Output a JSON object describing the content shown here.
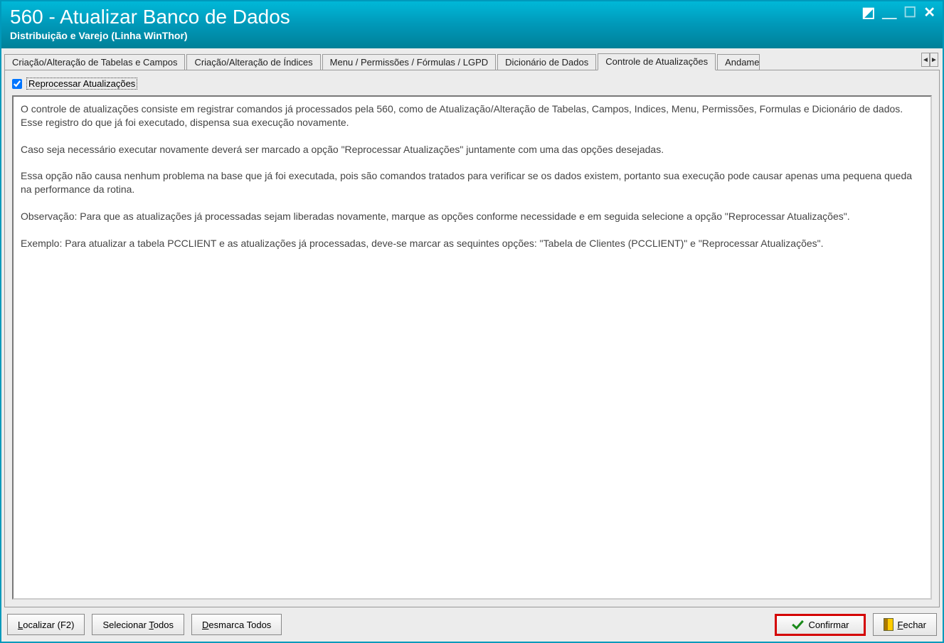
{
  "window": {
    "title": "560 - Atualizar Banco de Dados",
    "subtitle": "Distribuição e Varejo (Linha WinThor)"
  },
  "tabs": [
    "Criação/Alteração de Tabelas e Campos",
    "Criação/Alteração de Índices",
    "Menu / Permissões / Fórmulas / LGPD",
    "Dicionário de Dados",
    "Controle de Atualizações",
    "Andame"
  ],
  "active_tab_index": 4,
  "checkbox": {
    "label": "Reprocessar Atualizações",
    "checked": true
  },
  "info_text": "O controle de atualizações consiste em registrar comandos já processados pela 560, como de Atualização/Alteração de Tabelas, Campos, Indices, Menu, Permissões, Formulas e Dicionário de dados. Esse registro do que já foi executado, dispensa sua execução novamente.\n\nCaso seja necessário executar novamente deverá ser marcado a opção \"Reprocessar Atualizações\" juntamente com uma das opções desejadas.\n\nEssa opção não causa nenhum problema na base que já foi executada, pois são comandos tratados para verificar se os dados existem, portanto sua execução pode causar apenas uma pequena queda na performance da rotina.\n\nObservação: Para que as atualizações já processadas sejam liberadas novamente, marque as opções conforme necessidade e em seguida selecione a opção \"Reprocessar Atualizações\".\n\nExemplo: Para atualizar a tabela PCCLIENT e as atualizações já processadas, deve-se marcar as sequintes opções: \"Tabela de Clientes (PCCLIENT)\" e \"Reprocessar Atualizações\".",
  "buttons": {
    "localizar": "Localizar (F2)",
    "selecionar_todos_pre": "Selecionar ",
    "selecionar_todos_u": "T",
    "selecionar_todos_post": "odos",
    "desmarca_todos_pre": "",
    "desmarca_todos_u": "D",
    "desmarca_todos_post": "esmarca Todos",
    "confirmar": "Confirmar",
    "fechar_pre": "",
    "fechar_u": "F",
    "fechar_post": "echar"
  }
}
